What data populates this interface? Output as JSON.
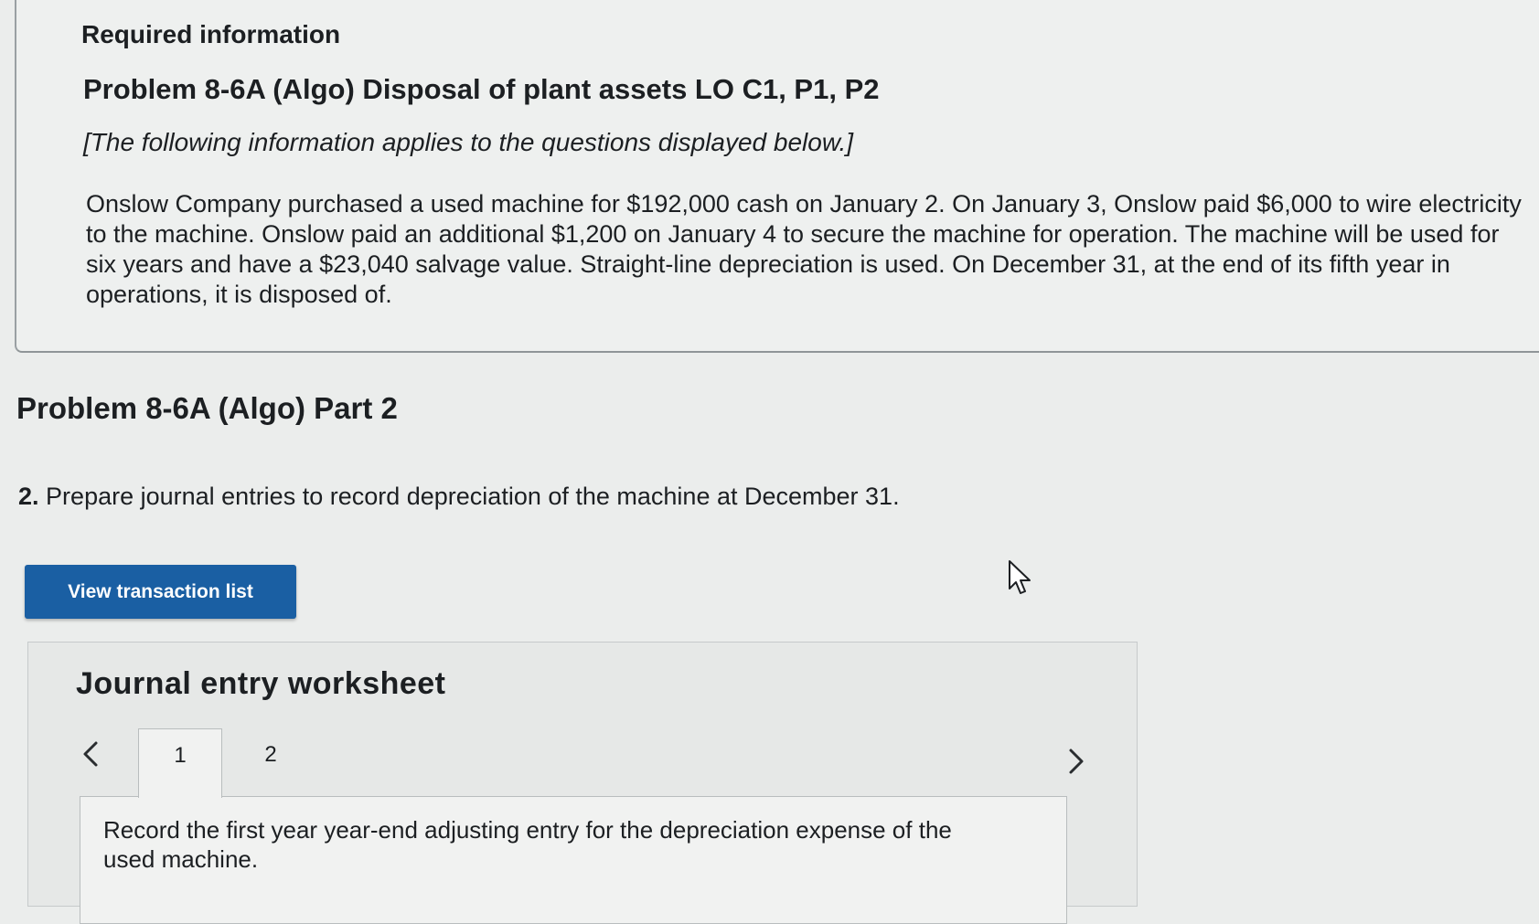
{
  "info": {
    "required_label": "Required information",
    "problem_title": "Problem 8-6A (Algo) Disposal of plant assets LO C1, P1, P2",
    "note": "[The following information applies to the questions displayed below.]",
    "paragraph": "Onslow Company purchased a used machine for $192,000 cash on January 2. On January 3, Onslow paid $6,000 to wire electricity to the machine. Onslow paid an additional $1,200 on January 4 to secure the machine for operation. The machine will be used for six years and have a $23,040 salvage value. Straight-line depreciation is used. On December 31, at the end of its fifth year in operations, it is disposed of."
  },
  "part": {
    "title": "Problem 8-6A (Algo) Part 2",
    "question_number": "2.",
    "question_text": "Prepare journal entries to record depreciation of the machine at December 31."
  },
  "actions": {
    "view_transaction_list": "View transaction list"
  },
  "worksheet": {
    "title": "Journal entry worksheet",
    "tabs": [
      {
        "label": "1",
        "active": true
      },
      {
        "label": "2",
        "active": false
      }
    ],
    "instruction": "Record the first year year-end adjusting entry for the depreciation expense of the used machine."
  },
  "icons": {
    "prev": "chevron-left-icon",
    "next": "chevron-right-icon",
    "cursor": "mouse-pointer-icon"
  },
  "colors": {
    "button_bg": "#1a5fa3",
    "button_text": "#ffffff",
    "page_bg": "#ebedec"
  }
}
